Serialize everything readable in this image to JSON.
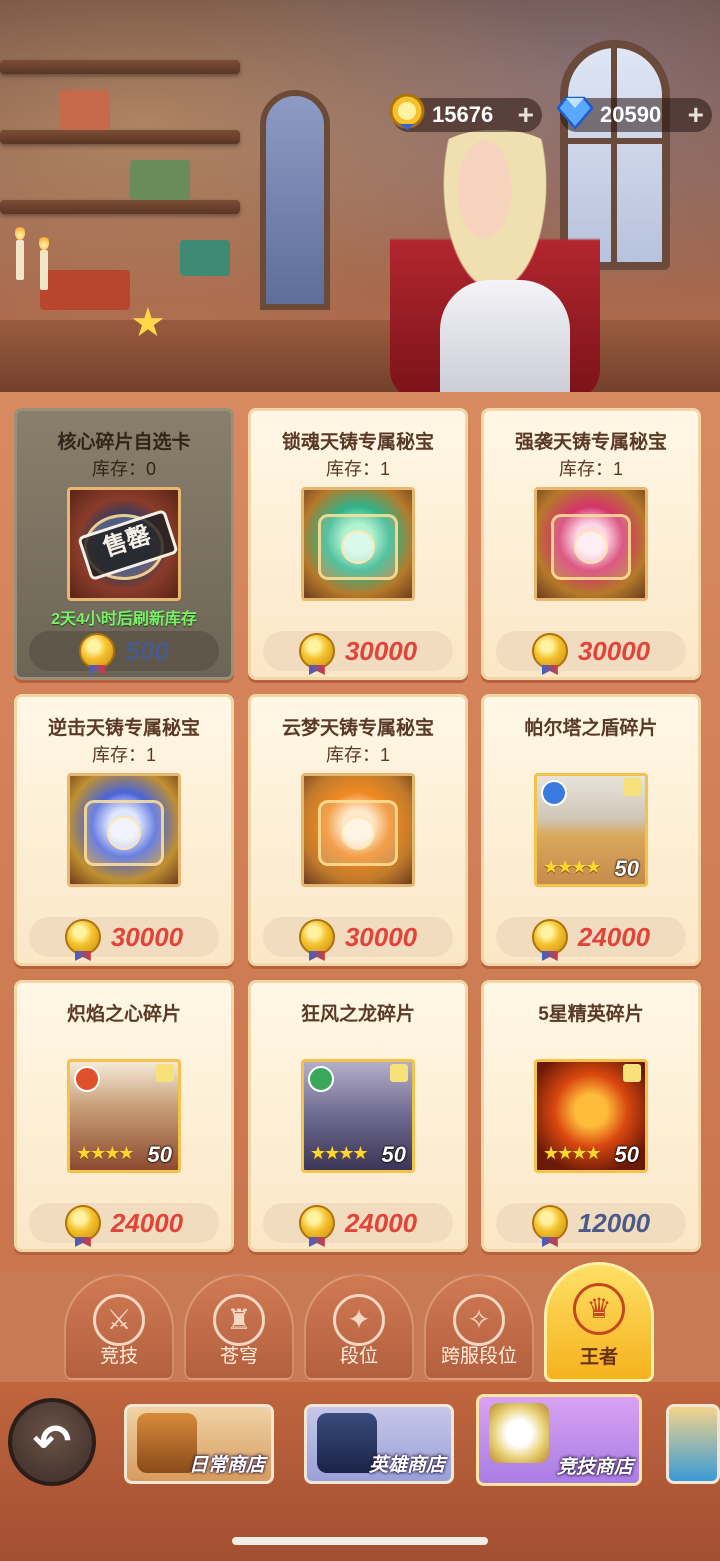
{
  "currency": {
    "gold": "15676",
    "gems": "20590",
    "plus": "+"
  },
  "shop_items": [
    {
      "title": "核心碎片自选卡",
      "stock": "库存：0",
      "price": "500",
      "sold_out": true,
      "stamp": "售罄",
      "refresh": "2天4小时后刷新库存"
    },
    {
      "title": "锁魂天铸专属秘宝",
      "stock": "库存：1",
      "price": "30000"
    },
    {
      "title": "强袭天铸专属秘宝",
      "stock": "库存：1",
      "price": "30000"
    },
    {
      "title": "逆击天铸专属秘宝",
      "stock": "库存：1",
      "price": "30000"
    },
    {
      "title": "云梦天铸专属秘宝",
      "stock": "库存：1",
      "price": "30000"
    },
    {
      "title": "帕尔塔之盾碎片",
      "price": "24000",
      "stars": "★★★★",
      "count": "50"
    },
    {
      "title": "炽焰之心碎片",
      "price": "24000",
      "stars": "★★★★",
      "count": "50"
    },
    {
      "title": "狂风之龙碎片",
      "price": "24000",
      "stars": "★★★★",
      "count": "50"
    },
    {
      "title": "5星精英碎片",
      "price": "12000",
      "stars": "★★★★",
      "count": "50"
    }
  ],
  "tabs": [
    {
      "label": "竞技",
      "icon": "crossed-swords-icon",
      "glyph": "⚔"
    },
    {
      "label": "苍穹",
      "icon": "crown-helmet-icon",
      "glyph": "♜"
    },
    {
      "label": "段位",
      "icon": "rank-emblem-icon",
      "glyph": "✦"
    },
    {
      "label": "跨服段位",
      "icon": "cross-server-rank-icon",
      "glyph": "✧"
    },
    {
      "label": "王者",
      "icon": "trophy-icon",
      "glyph": "♛",
      "active": true
    }
  ],
  "shops": [
    {
      "label": "日常商店",
      "icon": "treasure-chest-icon"
    },
    {
      "label": "英雄商店",
      "icon": "hero-card-icon"
    },
    {
      "label": "竞技商店",
      "icon": "gold-cup-icon",
      "active": true
    }
  ],
  "back": "↶",
  "colors": {
    "price_red": "#e2443a",
    "price_blue": "#4a5a8a",
    "active_tab": "#f5b21e",
    "refresh_green": "#7cf06a"
  }
}
